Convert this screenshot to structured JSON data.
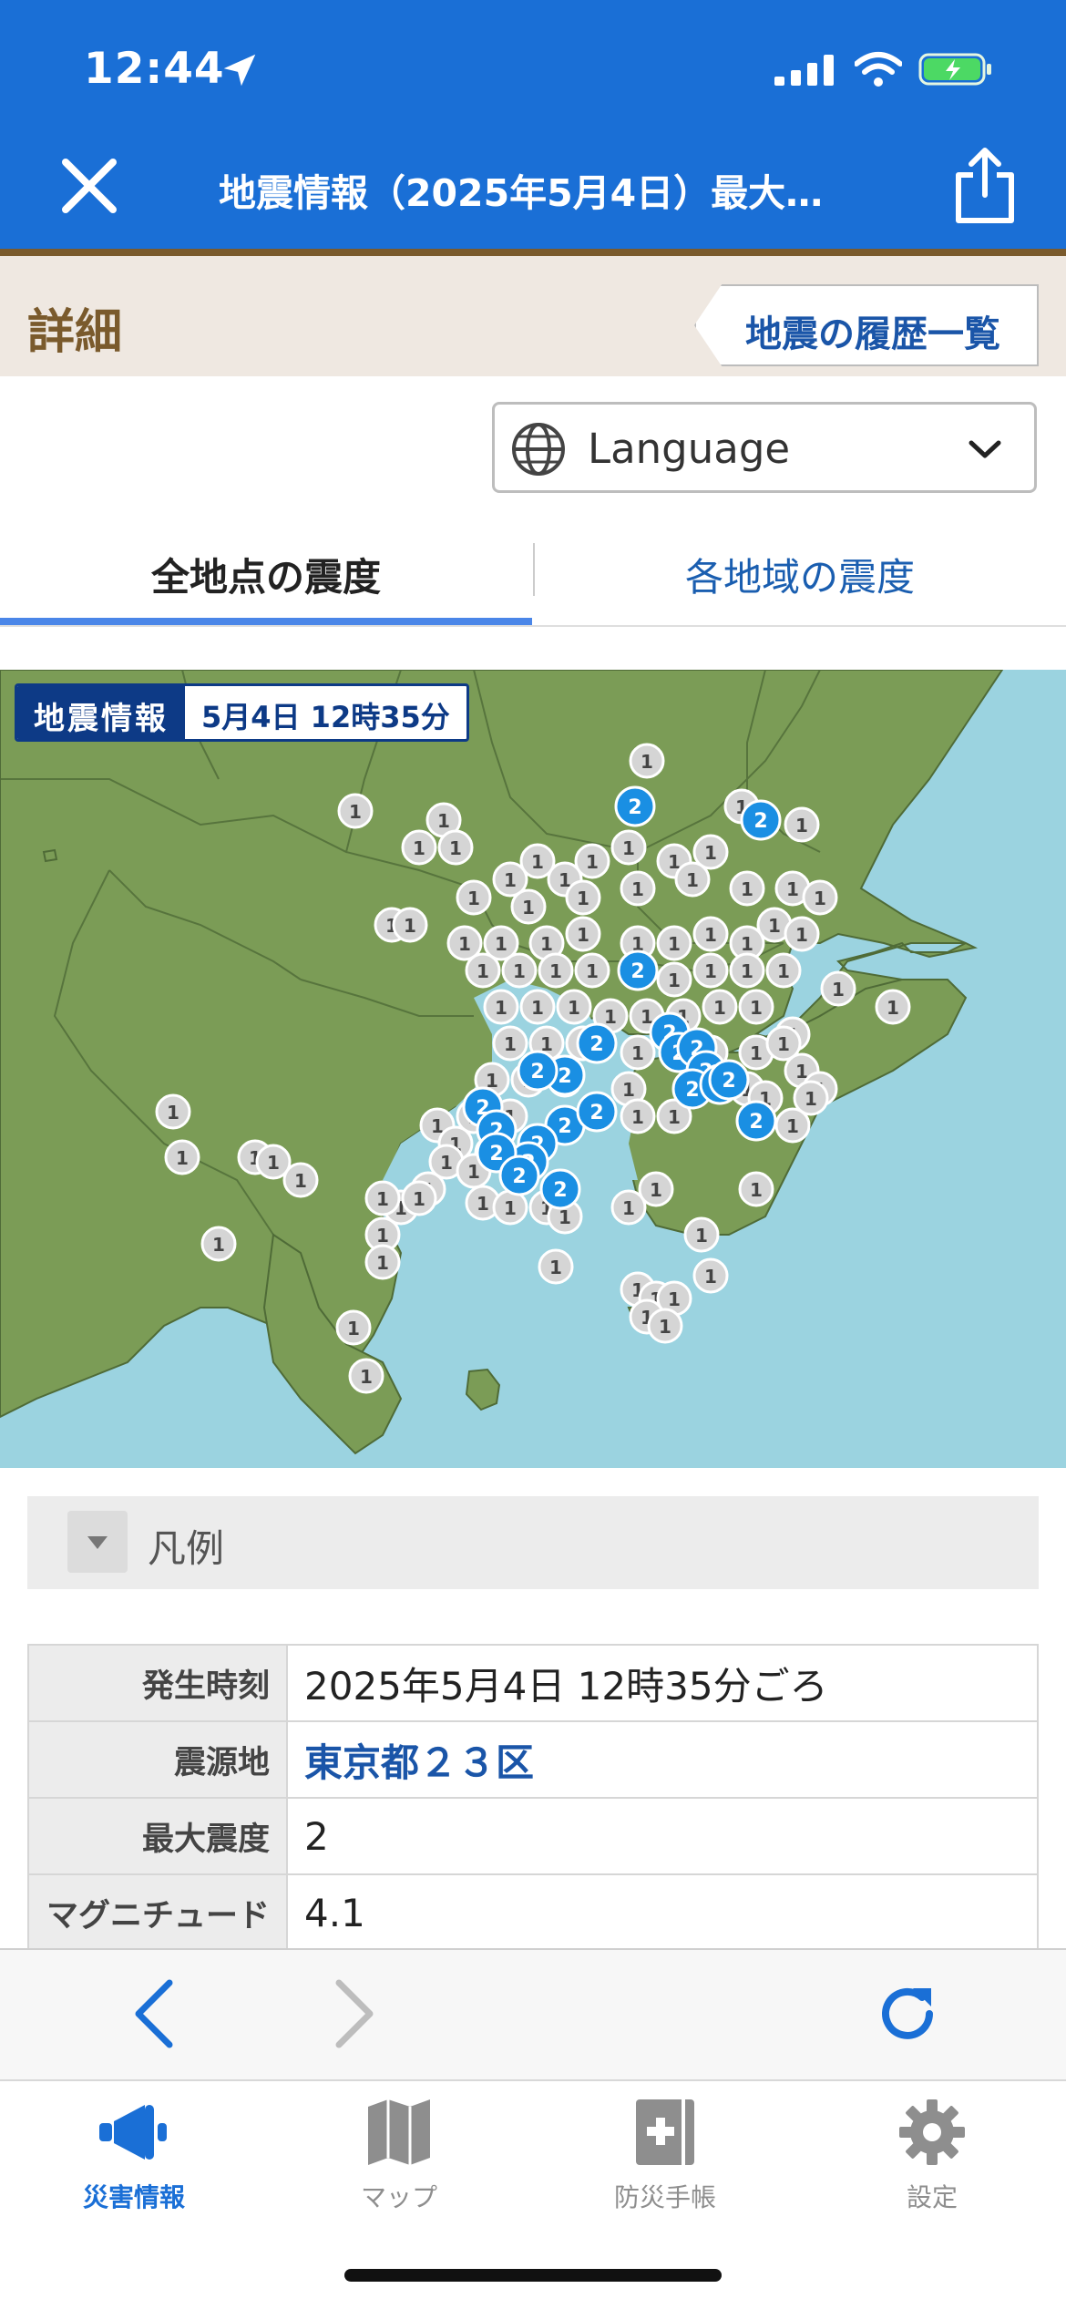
{
  "status_bar": {
    "time": "12:44"
  },
  "nav": {
    "title": "地震情報（2025年5月4日）最大…"
  },
  "detail": {
    "title": "詳細",
    "history_button": "地震の履歴一覧"
  },
  "language": {
    "label": "Language"
  },
  "tabs": [
    {
      "label": "全地点の震度",
      "selected": true
    },
    {
      "label": "各地域の震度",
      "selected": false
    }
  ],
  "map": {
    "badge_title": "地震情報",
    "badge_time": "5月4日 12時35分",
    "colors": {
      "sea": "#9bd3e0",
      "land": "#7b9c56",
      "intensity_1": "#d5d5d5",
      "intensity_2": "#1a8fe3"
    }
  },
  "legend": {
    "label": "凡例"
  },
  "info": [
    {
      "key": "発生時刻",
      "value": "2025年5月4日 12時35分ごろ"
    },
    {
      "key": "震源地",
      "value": "東京都２３区"
    },
    {
      "key": "最大震度",
      "value": "2"
    },
    {
      "key": "マグニチュード",
      "value": "4.1"
    }
  ],
  "tabbar": {
    "items": [
      {
        "label": "災害情報",
        "icon": "megaphone-icon",
        "active": true
      },
      {
        "label": "マップ",
        "icon": "map-icon",
        "active": false
      },
      {
        "label": "防災手帳",
        "icon": "handbook-icon",
        "active": false
      },
      {
        "label": "設定",
        "icon": "gear-icon",
        "active": false
      }
    ],
    "active_color": "#1a6fd6",
    "inactive_color": "#8e8e8e"
  }
}
